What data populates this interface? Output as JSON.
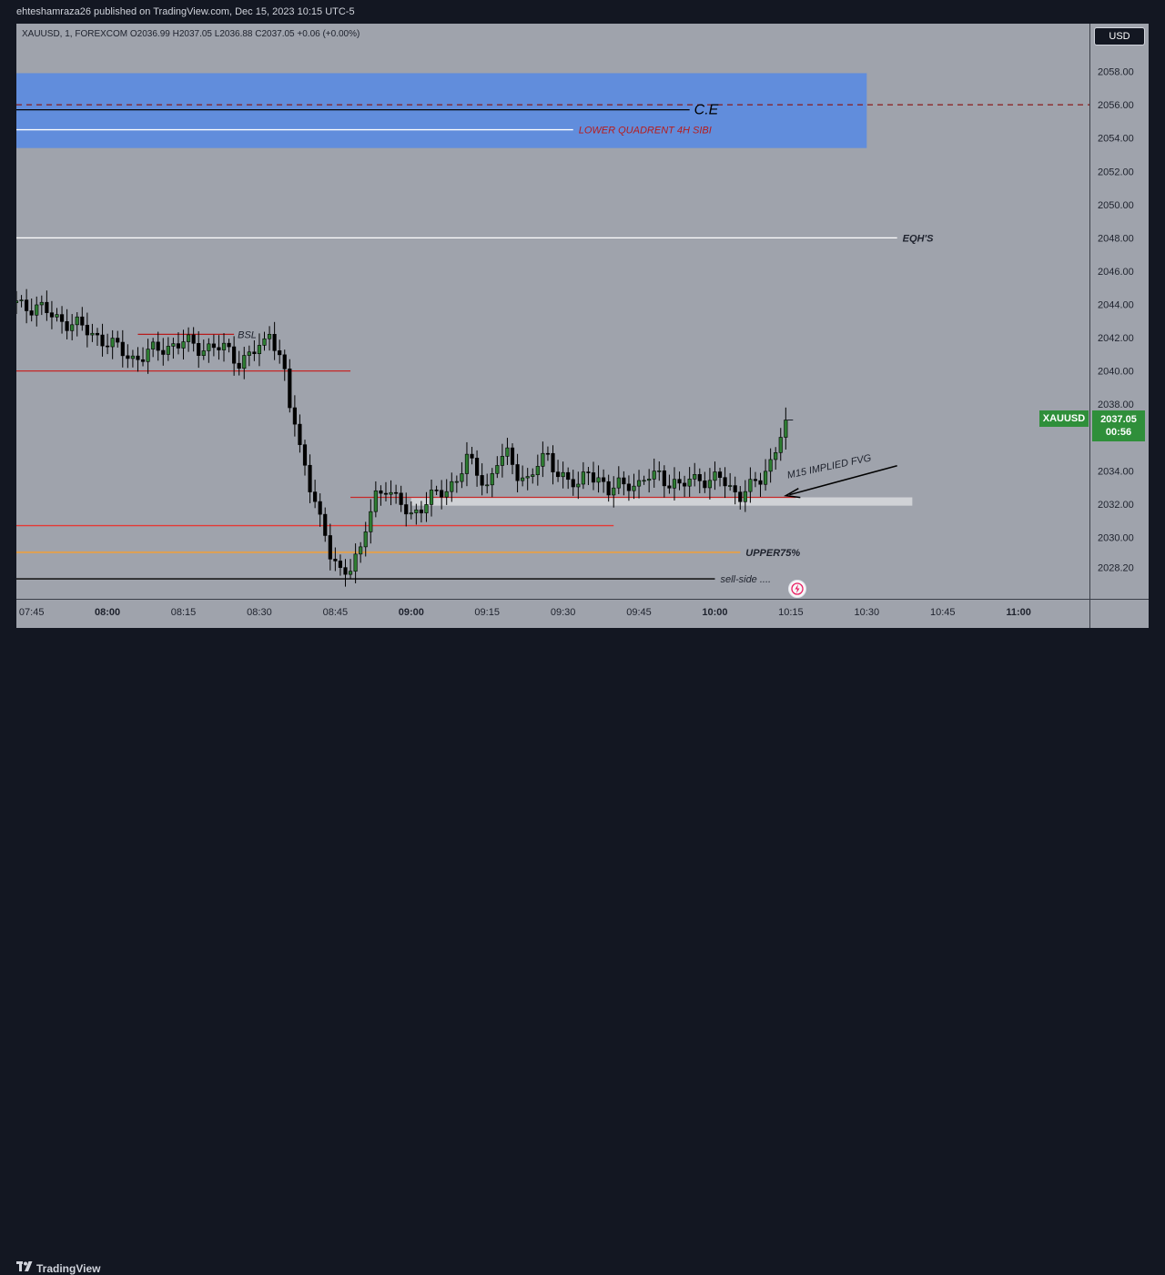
{
  "header": {
    "published_text": "ehteshamraza26 published on TradingView.com, Dec 15, 2023 10:15 UTC-5"
  },
  "symbol_info": "XAUUSD, 1, FOREXCOM  O2036.99  H2037.05  L2036.88  C2037.05  +0.06 (+0.00%)",
  "currency_badge": "USD",
  "last_price": {
    "symbol": "XAUUSD",
    "price": "2037.05",
    "countdown": "00:56",
    "value": 2037.05
  },
  "footer": {
    "brand": "TradingView"
  },
  "colors": {
    "chart_background": "#9fa3ac",
    "bull_candle": "#2e7d32",
    "bear_candle": "#000000",
    "zone_fill": "#5b8be0",
    "price_label_green": "#2f8f3a"
  },
  "chart_data": {
    "type": "candlestick",
    "symbol": "XAUUSD",
    "timeframe": "1",
    "broker": "FOREXCOM",
    "ylim": [
      2026.3,
      2059.4
    ],
    "y_ticks": [
      2028.2,
      2030.0,
      2032.0,
      2034.0,
      2036.0,
      2038.0,
      2040.0,
      2042.0,
      2044.0,
      2046.0,
      2048.0,
      2050.0,
      2052.0,
      2054.0,
      2056.0,
      2058.0
    ],
    "y_tick_labels": [
      "2028.20",
      "2030.00",
      "2032.00",
      "2034.00",
      "2036.00",
      "2038.00",
      "2040.00",
      "2042.00",
      "2044.00",
      "2046.00",
      "2048.00",
      "2050.00",
      "2052.00",
      "2054.00",
      "2056.00",
      "2058.00"
    ],
    "x_start": "07:42",
    "x_end": "11:14",
    "x_ticks": [
      {
        "time": "07:45",
        "label": "07:45",
        "bold": false
      },
      {
        "time": "08:00",
        "label": "08:00",
        "bold": true
      },
      {
        "time": "08:15",
        "label": "08:15",
        "bold": false
      },
      {
        "time": "08:30",
        "label": "08:30",
        "bold": false
      },
      {
        "time": "08:45",
        "label": "08:45",
        "bold": false
      },
      {
        "time": "09:00",
        "label": "09:00",
        "bold": true
      },
      {
        "time": "09:15",
        "label": "09:15",
        "bold": false
      },
      {
        "time": "09:30",
        "label": "09:30",
        "bold": false
      },
      {
        "time": "09:45",
        "label": "09:45",
        "bold": false
      },
      {
        "time": "10:00",
        "label": "10:00",
        "bold": true
      },
      {
        "time": "10:15",
        "label": "10:15",
        "bold": false
      },
      {
        "time": "10:30",
        "label": "10:30",
        "bold": false
      },
      {
        "time": "10:45",
        "label": "10:45",
        "bold": false
      },
      {
        "time": "11:00",
        "label": "11:00",
        "bold": true
      }
    ],
    "close_path": [
      [
        "07:42",
        2044.1
      ],
      [
        "07:46",
        2043.8
      ],
      [
        "07:50",
        2043.2
      ],
      [
        "07:54",
        2042.7
      ],
      [
        "07:58",
        2042.1
      ],
      [
        "08:02",
        2041.3
      ],
      [
        "08:05",
        2040.8
      ],
      [
        "08:07",
        2040.9
      ],
      [
        "08:10",
        2041.3
      ],
      [
        "08:13",
        2041.6
      ],
      [
        "08:15",
        2041.7
      ],
      [
        "08:18",
        2041.4
      ],
      [
        "08:21",
        2041.5
      ],
      [
        "08:24",
        2041.1
      ],
      [
        "08:26",
        2040.6
      ],
      [
        "08:28",
        2041.0
      ],
      [
        "08:31",
        2041.5
      ],
      [
        "08:32",
        2042.4
      ],
      [
        "08:33",
        2041.8
      ],
      [
        "08:34",
        2041.0
      ],
      [
        "08:35",
        2039.8
      ],
      [
        "08:36",
        2037.8
      ],
      [
        "08:37",
        2036.8
      ],
      [
        "08:38",
        2035.2
      ],
      [
        "08:39",
        2034.3
      ],
      [
        "08:40",
        2033.3
      ],
      [
        "08:41",
        2032.4
      ],
      [
        "08:42",
        2031.0
      ],
      [
        "08:43",
        2029.9
      ],
      [
        "08:44",
        2028.8
      ],
      [
        "08:46",
        2028.0
      ],
      [
        "08:48",
        2028.4
      ],
      [
        "08:50",
        2029.0
      ],
      [
        "08:51",
        2030.4
      ],
      [
        "08:52",
        2031.6
      ],
      [
        "08:53",
        2032.6
      ],
      [
        "08:55",
        2033.1
      ],
      [
        "08:57",
        2032.1
      ],
      [
        "09:00",
        2031.4
      ],
      [
        "09:02",
        2031.9
      ],
      [
        "09:04",
        2032.3
      ],
      [
        "09:07",
        2032.9
      ],
      [
        "09:09",
        2033.6
      ],
      [
        "09:11",
        2034.6
      ],
      [
        "09:13",
        2033.9
      ],
      [
        "09:15",
        2033.1
      ],
      [
        "09:17",
        2034.6
      ],
      [
        "09:19",
        2034.8
      ],
      [
        "09:21",
        2033.9
      ],
      [
        "09:23",
        2033.5
      ],
      [
        "09:25",
        2034.3
      ],
      [
        "09:27",
        2034.8
      ],
      [
        "09:29",
        2034.0
      ],
      [
        "09:31",
        2033.4
      ],
      [
        "09:33",
        2032.9
      ],
      [
        "09:35",
        2034.2
      ],
      [
        "09:37",
        2033.5
      ],
      [
        "09:39",
        2032.6
      ],
      [
        "09:41",
        2033.2
      ],
      [
        "09:43",
        2033.4
      ],
      [
        "09:45",
        2033.0
      ],
      [
        "09:47",
        2033.6
      ],
      [
        "09:49",
        2033.9
      ],
      [
        "09:51",
        2033.3
      ],
      [
        "09:53",
        2032.9
      ],
      [
        "09:55",
        2033.5
      ],
      [
        "09:57",
        2033.7
      ],
      [
        "09:59",
        2033.2
      ],
      [
        "10:01",
        2033.6
      ],
      [
        "10:03",
        2033.0
      ],
      [
        "10:05",
        2032.6
      ],
      [
        "10:07",
        2032.9
      ],
      [
        "10:09",
        2033.5
      ],
      [
        "10:11",
        2034.6
      ],
      [
        "10:13",
        2036.2
      ],
      [
        "10:14",
        2037.05
      ]
    ],
    "last_price": 2037.05,
    "zones": [
      {
        "label": "LOWER QUADRENT 4H SIBI",
        "from_price": 2053.4,
        "to_price": 2057.9,
        "x_from": "07:42",
        "x_to": "10:30"
      }
    ],
    "levels": [
      {
        "name": "c-e-dashed",
        "price": 2056.0,
        "style": "dashed",
        "color": "#8b1a1a",
        "x_from": "07:42",
        "x_to": "11:14",
        "label": ""
      },
      {
        "name": "c-e-line",
        "price": 2055.7,
        "style": "solid",
        "color": "#000000",
        "x_from": "07:42",
        "x_to": "09:55",
        "label": "C.E"
      },
      {
        "name": "lower-quadrant-line",
        "price": 2054.5,
        "style": "solid",
        "color": "#ffffff",
        "x_from": "07:42",
        "x_to": "09:32",
        "label": "LOWER QUADRENT 4H SIBI"
      },
      {
        "name": "eqhs-line",
        "price": 2048.0,
        "style": "solid",
        "color": "#ffffff",
        "x_from": "07:42",
        "x_to": "10:36",
        "label": "EQH'S"
      },
      {
        "name": "bsl-line",
        "price": 2042.2,
        "style": "solid",
        "color": "#b71c1c",
        "x_from": "08:06",
        "x_to": "08:25",
        "label": "BSL"
      },
      {
        "name": "red-level-2040",
        "price": 2040.0,
        "style": "solid",
        "color": "#c62828",
        "x_from": "07:42",
        "x_to": "08:48",
        "label": ""
      },
      {
        "name": "fvg-top-red",
        "price": 2032.4,
        "style": "solid",
        "color": "#c62828",
        "x_from": "08:48",
        "x_to": "10:16",
        "label": ""
      },
      {
        "name": "red-level-2030-7",
        "price": 2030.7,
        "style": "solid",
        "color": "#e53935",
        "x_from": "07:42",
        "x_to": "09:40",
        "label": ""
      },
      {
        "name": "upper75-line",
        "price": 2029.1,
        "style": "solid",
        "color": "#e0a050",
        "x_from": "07:42",
        "x_to": "10:05",
        "label": "UPPER75%"
      },
      {
        "name": "sell-side-line",
        "price": 2027.5,
        "style": "solid",
        "color": "#000000",
        "x_from": "07:42",
        "x_to": "10:00",
        "label": "sell-side ...."
      }
    ],
    "boxes": [
      {
        "name": "m15-implied-fvg-box",
        "from_price": 2031.9,
        "to_price": 2032.4,
        "x_from": "09:00",
        "x_to": "10:39",
        "color": "#d0d2d6"
      }
    ],
    "annotations": [
      {
        "text": "M15 IMPLIED FVG",
        "type": "arrow",
        "from_time": "10:36",
        "from_price": 2034.3,
        "to_time": "10:14",
        "to_price": 2032.5
      }
    ]
  }
}
